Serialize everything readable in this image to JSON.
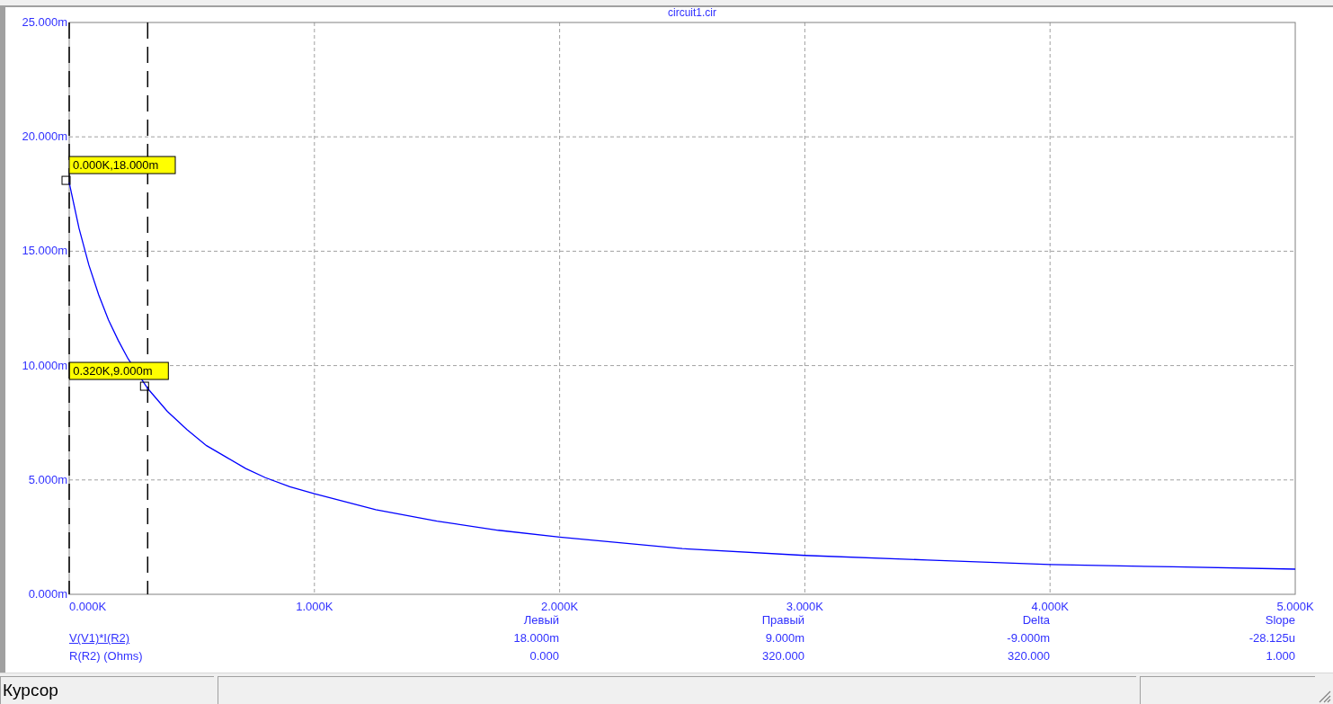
{
  "plot": {
    "chart_data": {
      "type": "line",
      "title": "circuit1.cir",
      "grid": true,
      "x": [
        0,
        0.04,
        0.08,
        0.12,
        0.16,
        0.2,
        0.24,
        0.32,
        0.4,
        0.48,
        0.56,
        0.64,
        0.72,
        0.8,
        0.9,
        1.0,
        1.25,
        1.5,
        1.75,
        2.0,
        2.5,
        3.0,
        3.5,
        4.0,
        4.5,
        5.0
      ],
      "series": [
        {
          "name": "V(V1)*I(R2)",
          "color": "#0000ff",
          "values": [
            18,
            16,
            14.4,
            13.1,
            12,
            11.1,
            10.3,
            9,
            8,
            7.2,
            6.5,
            6,
            5.5,
            5.1,
            4.7,
            4.4,
            3.7,
            3.2,
            2.8,
            2.5,
            2.0,
            1.7,
            1.5,
            1.3,
            1.2,
            1.1
          ]
        }
      ],
      "xlim": [
        0,
        5
      ],
      "ylim": [
        0,
        25
      ],
      "xticks": [
        {
          "value": 0,
          "label": "0.000K"
        },
        {
          "value": 1,
          "label": "1.000K"
        },
        {
          "value": 2,
          "label": "2.000K"
        },
        {
          "value": 3,
          "label": "3.000K"
        },
        {
          "value": 4,
          "label": "4.000K"
        },
        {
          "value": 5,
          "label": "5.000K"
        }
      ],
      "yticks": [
        {
          "value": 0,
          "label": "0.000m"
        },
        {
          "value": 5,
          "label": "5.000m"
        },
        {
          "value": 10,
          "label": "10.000m"
        },
        {
          "value": 15,
          "label": "15.000m"
        },
        {
          "value": 20,
          "label": "20.000m"
        },
        {
          "value": 25,
          "label": "25.000m"
        }
      ],
      "ref_lines": [
        {
          "axis": "x",
          "value": 0
        },
        {
          "axis": "x",
          "value": 0.32
        }
      ],
      "annotations": [
        {
          "x": 0,
          "y": 18,
          "text": "0.000K,18.000m"
        },
        {
          "x": 0.32,
          "y": 9,
          "text": "0.320K,9.000m"
        }
      ]
    }
  },
  "cursor_table": {
    "headers": [
      "Левый",
      "Правый",
      "Delta",
      "Slope"
    ],
    "rows": [
      {
        "kind": "trace",
        "selected": true,
        "values": [
          "18.000m",
          "9.000m",
          "-9.000m",
          "-28.125u"
        ]
      },
      {
        "kind": "axis",
        "name": "R(R2) (Ohms)",
        "selected": false,
        "values": [
          "0.000",
          "320.000",
          "320.000",
          "1.000"
        ]
      }
    ]
  },
  "status_bar": {
    "mode": "Курсор"
  }
}
